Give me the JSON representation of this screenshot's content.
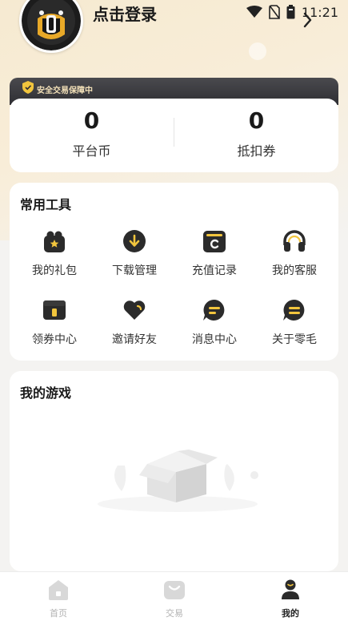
{
  "status_bar": {
    "time": "11:21",
    "wifi_icon": "wifi-icon",
    "sim_icon": "no-sim-icon",
    "battery_icon": "battery-icon"
  },
  "profile": {
    "login_label": "点击登录",
    "avatar_icon": "avatar-icon",
    "arrow_icon": "chevron-right-icon"
  },
  "wallet": {
    "secure_badge": "安全交易保障中",
    "items": [
      {
        "value": "0",
        "label": "平台币"
      },
      {
        "value": "0",
        "label": "抵扣券"
      }
    ]
  },
  "tools": {
    "title": "常用工具",
    "items": [
      {
        "label": "我的礼包",
        "icon": "gift-icon"
      },
      {
        "label": "下载管理",
        "icon": "download-icon"
      },
      {
        "label": "充值记录",
        "icon": "recharge-record-icon"
      },
      {
        "label": "我的客服",
        "icon": "headset-icon"
      },
      {
        "label": "领券中心",
        "icon": "coupon-center-icon"
      },
      {
        "label": "邀请好友",
        "icon": "invite-heart-icon"
      },
      {
        "label": "消息中心",
        "icon": "message-icon"
      },
      {
        "label": "关于零毛",
        "icon": "about-icon"
      }
    ]
  },
  "my_games": {
    "title": "我的游戏",
    "empty_icon": "empty-box-icon"
  },
  "tabbar": {
    "items": [
      {
        "label": "首页",
        "icon": "home-icon"
      },
      {
        "label": "交易",
        "icon": "trade-bag-icon"
      },
      {
        "label": "我的",
        "icon": "profile-icon"
      }
    ],
    "active_index": 2
  },
  "colors": {
    "accent": "#2b2b2b",
    "gold": "#f2c53d",
    "background": "#f4f3f1"
  }
}
